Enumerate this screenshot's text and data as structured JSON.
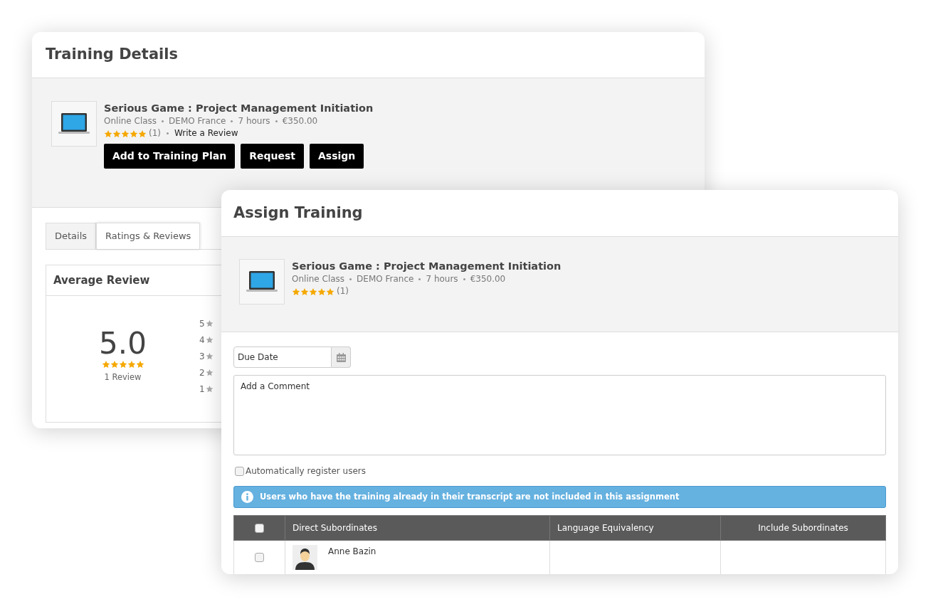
{
  "training_details": {
    "title": "Training Details",
    "course": {
      "title": "Serious Game : Project Management Initiation",
      "meta": [
        "Online Class",
        "DEMO France",
        "7 hours",
        "€350.00"
      ],
      "stars": 5,
      "review_count": "(1)",
      "review_link": "Write a Review"
    },
    "buttons": [
      "Add to Training Plan",
      "Request",
      "Assign"
    ],
    "tabs": [
      {
        "label": "Details",
        "selected": false
      },
      {
        "label": "Ratings & Reviews",
        "selected": true
      }
    ],
    "average_review": {
      "title": "Average Review",
      "score": "5.0",
      "stars": 5,
      "count": "1 Review",
      "distribution": [
        "5",
        "4",
        "3",
        "2",
        "1"
      ]
    }
  },
  "assign_training": {
    "title": "Assign Training",
    "course": {
      "title": "Serious Game : Project Management Initiation",
      "meta": [
        "Online Class",
        "DEMO France",
        "7 hours",
        "€350.00"
      ],
      "stars": 5,
      "review_count": "(1)"
    },
    "due_date": {
      "placeholder": "Due Date"
    },
    "comment": {
      "placeholder": "Add a Comment"
    },
    "auto_register": {
      "label": "Automatically register users",
      "checked": false
    },
    "info": "Users who have the training already in their transcript are not included in this assignment",
    "table": {
      "select_all": {
        "checked": false
      },
      "columns": [
        "Direct Subordinates",
        "Language Equivalency",
        "Include Subordinates"
      ],
      "rows": [
        {
          "name": "Anne Bazin",
          "checked": false
        }
      ]
    }
  }
}
